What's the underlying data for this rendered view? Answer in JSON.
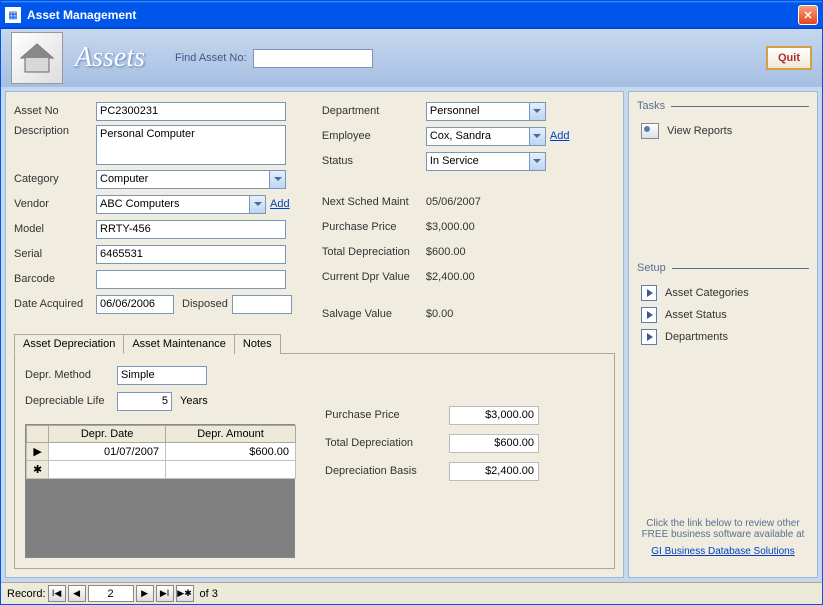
{
  "window": {
    "title": "Asset Management"
  },
  "header": {
    "title": "Assets",
    "find_label": "Find Asset No:",
    "find_value": "",
    "quit_label": "Quit"
  },
  "form": {
    "asset_no_label": "Asset No",
    "asset_no": "PC2300231",
    "description_label": "Description",
    "description": "Personal Computer",
    "category_label": "Category",
    "category": "Computer",
    "vendor_label": "Vendor",
    "vendor": "ABC Computers",
    "vendor_add": "Add",
    "model_label": "Model",
    "model": "RRTY-456",
    "serial_label": "Serial",
    "serial": "6465531",
    "barcode_label": "Barcode",
    "barcode": "",
    "date_acquired_label": "Date Acquired",
    "date_acquired": "06/06/2006",
    "disposed_label": "Disposed",
    "disposed": "",
    "department_label": "Department",
    "department": "Personnel",
    "employee_label": "Employee",
    "employee": "Cox, Sandra",
    "employee_add": "Add",
    "status_label": "Status",
    "status": "In Service",
    "next_maint_label": "Next Sched Maint",
    "next_maint": "05/06/2007",
    "purchase_price_label": "Purchase Price",
    "purchase_price": "$3,000.00",
    "total_depr_label": "Total Depreciation",
    "total_depr": "$600.00",
    "curr_dpr_label": "Current Dpr Value",
    "curr_dpr": "$2,400.00",
    "salvage_label": "Salvage Value",
    "salvage": "$0.00"
  },
  "tabs": {
    "t1": "Asset Depreciation",
    "t2": "Asset Maintenance",
    "t3": "Notes"
  },
  "depr": {
    "method_label": "Depr. Method",
    "method": "Simple",
    "life_label": "Depreciable Life",
    "life": "5",
    "years": "Years",
    "col_date": "Depr. Date",
    "col_amount": "Depr. Amount",
    "row1_date": "01/07/2007",
    "row1_amount": "$600.00",
    "pp_label": "Purchase Price",
    "pp": "$3,000.00",
    "td_label": "Total Depreciation",
    "td": "$600.00",
    "db_label": "Depreciation Basis",
    "db": "$2,400.00"
  },
  "sidebar": {
    "tasks_title": "Tasks",
    "view_reports": "View Reports",
    "setup_title": "Setup",
    "asset_categories": "Asset Categories",
    "asset_status": "Asset Status",
    "departments": "Departments",
    "footer_text": "Click the link below to review other FREE business software available at",
    "footer_link": "GI Business Database Solutions"
  },
  "statusbar": {
    "record_label": "Record:",
    "current": "2",
    "of_label": "of  3"
  }
}
